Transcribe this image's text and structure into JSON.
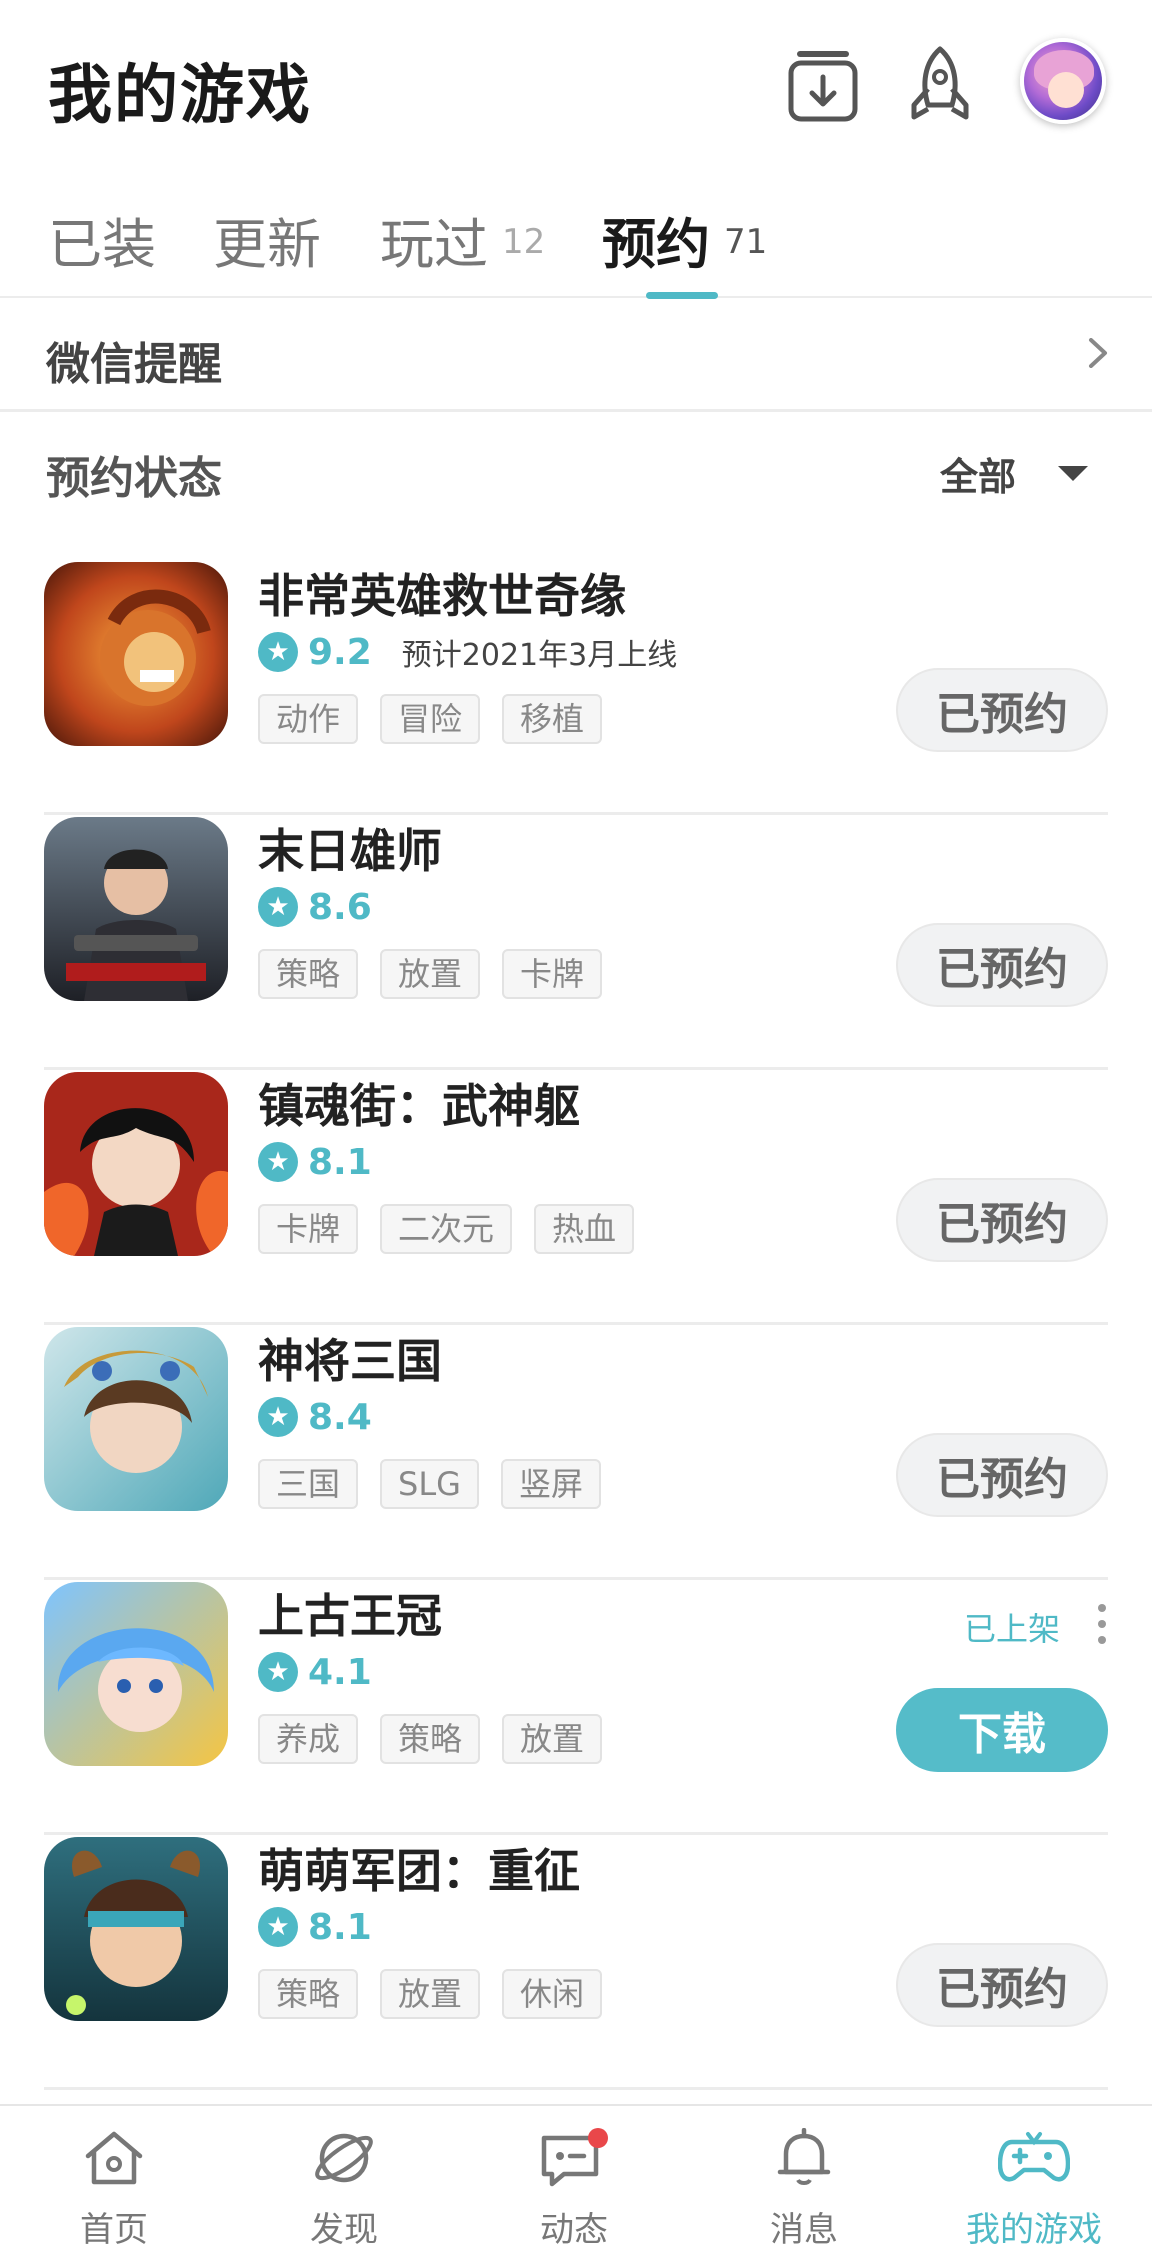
{
  "header": {
    "title": "我的游戏"
  },
  "tabs": [
    {
      "label": "已装",
      "count": ""
    },
    {
      "label": "更新",
      "count": ""
    },
    {
      "label": "玩过",
      "count": "12"
    },
    {
      "label": "预约",
      "count": "71"
    }
  ],
  "wechat_reminder": {
    "label": "微信提醒"
  },
  "reservation_status": {
    "label": "预约状态",
    "filter": "全部"
  },
  "games": [
    {
      "name": "非常英雄救世奇缘",
      "score": "9.2",
      "release": "预计2021年3月上线",
      "tags": [
        "动作",
        "冒险",
        "移植"
      ],
      "button": "已预约",
      "status": ""
    },
    {
      "name": "末日雄师",
      "score": "8.6",
      "release": "",
      "tags": [
        "策略",
        "放置",
        "卡牌"
      ],
      "button": "已预约",
      "status": ""
    },
    {
      "name": "镇魂街：武神躯",
      "score": "8.1",
      "release": "",
      "tags": [
        "卡牌",
        "二次元",
        "热血"
      ],
      "button": "已预约",
      "status": ""
    },
    {
      "name": "神将三国",
      "score": "8.4",
      "release": "",
      "tags": [
        "三国",
        "SLG",
        "竖屏"
      ],
      "button": "已预约",
      "status": ""
    },
    {
      "name": "上古王冠",
      "score": "4.1",
      "release": "",
      "tags": [
        "养成",
        "策略",
        "放置"
      ],
      "button": "下载",
      "status": "已上架"
    },
    {
      "name": "萌萌军团：重征",
      "score": "8.1",
      "release": "",
      "tags": [
        "策略",
        "放置",
        "休闲"
      ],
      "button": "已预约",
      "status": ""
    }
  ],
  "nav": [
    {
      "label": "首页",
      "icon": "home-icon"
    },
    {
      "label": "发现",
      "icon": "planet-icon"
    },
    {
      "label": "动态",
      "icon": "chat-icon"
    },
    {
      "label": "消息",
      "icon": "bell-icon"
    },
    {
      "label": "我的游戏",
      "icon": "gamepad-icon"
    }
  ],
  "colors": {
    "accent": "#4fb9c6",
    "badge": "#e9474a"
  }
}
